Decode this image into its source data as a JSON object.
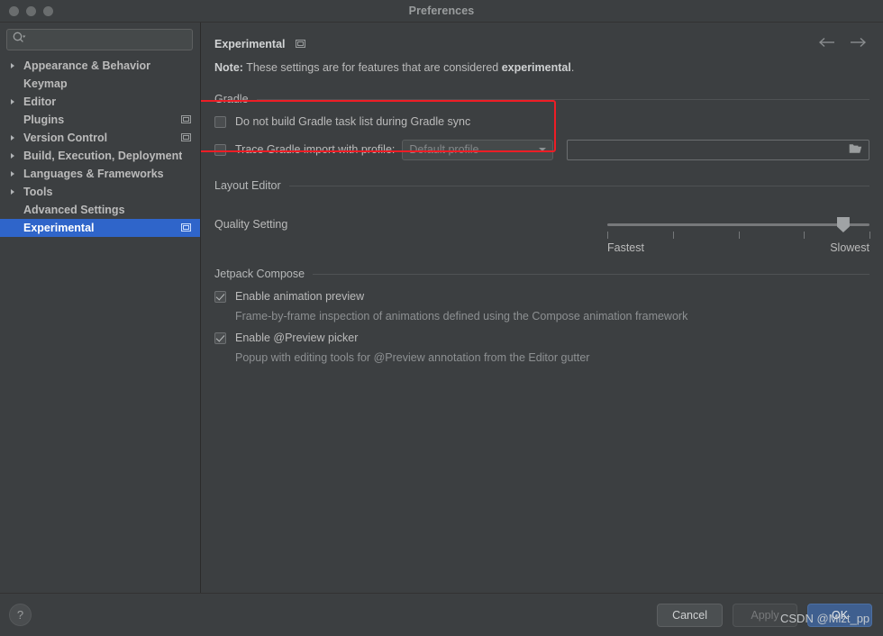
{
  "window": {
    "title": "Preferences",
    "traffic_lights": [
      "close-button",
      "minimize-button",
      "zoom-button"
    ]
  },
  "sidebar": {
    "search": {
      "value": "",
      "placeholder": ""
    },
    "items": [
      {
        "label": "Appearance & Behavior",
        "expandable": true,
        "panel_icon": false,
        "selected": false
      },
      {
        "label": "Keymap",
        "expandable": false,
        "panel_icon": false,
        "selected": false
      },
      {
        "label": "Editor",
        "expandable": true,
        "panel_icon": false,
        "selected": false
      },
      {
        "label": "Plugins",
        "expandable": false,
        "panel_icon": true,
        "selected": false
      },
      {
        "label": "Version Control",
        "expandable": true,
        "panel_icon": true,
        "selected": false
      },
      {
        "label": "Build, Execution, Deployment",
        "expandable": true,
        "panel_icon": false,
        "selected": false
      },
      {
        "label": "Languages & Frameworks",
        "expandable": true,
        "panel_icon": false,
        "selected": false
      },
      {
        "label": "Tools",
        "expandable": true,
        "panel_icon": false,
        "selected": false
      },
      {
        "label": "Advanced Settings",
        "expandable": false,
        "panel_icon": false,
        "selected": false
      },
      {
        "label": "Experimental",
        "expandable": false,
        "panel_icon": true,
        "selected": true
      }
    ]
  },
  "main": {
    "title": "Experimental",
    "note": {
      "prefix": "Note:",
      "text": " These settings are for features that are considered ",
      "emphasis": "experimental",
      "suffix": "."
    },
    "gradle": {
      "section_label": "Gradle",
      "do_not_build": {
        "label": "Do not build Gradle task list during Gradle sync",
        "checked": false
      },
      "trace_import": {
        "label": "Trace Gradle import with profile:",
        "checked": false,
        "profile_value": "Default profile",
        "path_value": ""
      }
    },
    "layout_editor": {
      "section_label": "Layout Editor",
      "quality_label": "Quality Setting",
      "slider": {
        "min_label": "Fastest",
        "max_label": "Slowest",
        "ticks": 5,
        "value_index": 4,
        "value_percent": 90
      }
    },
    "jetpack_compose": {
      "section_label": "Jetpack Compose",
      "options": [
        {
          "label": "Enable animation preview",
          "checked": true,
          "description": "Frame-by-frame inspection of animations defined using the Compose animation framework"
        },
        {
          "label": "Enable @Preview picker",
          "checked": true,
          "description": "Popup with editing tools for @Preview annotation from the Editor gutter"
        }
      ]
    }
  },
  "footer": {
    "help_label": "?",
    "cancel_label": "Cancel",
    "apply_label": "Apply",
    "ok_label": "OK"
  },
  "watermark": "CSDN @Mlzt_pp",
  "colors": {
    "background": "#3c3f41",
    "selection_blue": "#2f65ca",
    "primary_button": "#3f5f8f",
    "annotation_red": "#ee1d25",
    "text": "#bbbbbb",
    "muted_text": "#8d9092"
  }
}
